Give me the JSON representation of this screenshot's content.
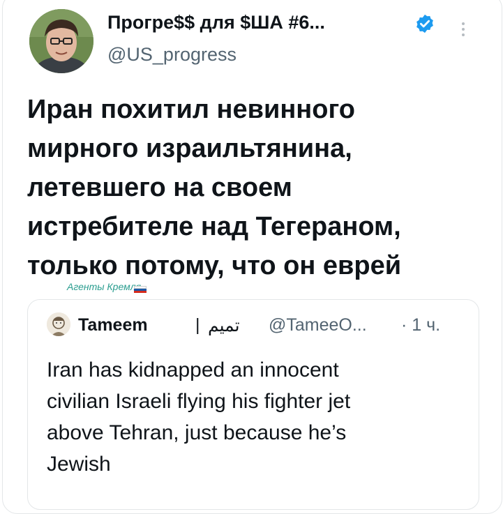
{
  "author": {
    "display_name": "Прогре$$ для $ША #6...",
    "handle": "@US_progress"
  },
  "tweet": {
    "lines": [
      "Иран похитил невинного",
      "мирного израильтянина,",
      "летевшего на своем",
      "истребителе над Тегераном,",
      "только потому, что он еврей"
    ]
  },
  "watermark": {
    "text": "Агенты Кремля"
  },
  "quoted": {
    "name": "Tameem",
    "separator": "|",
    "arabic_name": "تميم",
    "handle": "@TameeO...",
    "time": "· 1 ч.",
    "lines": [
      "Iran has kidnapped an innocent",
      "civilian Israeli flying his fighter jet",
      "above Tehran, just because he’s",
      "Jewish"
    ]
  },
  "colors": {
    "verified": "#1d9bf0",
    "secondary_text": "#536471",
    "border": "#e3e6e8",
    "watermark": "#2a9d8f"
  }
}
